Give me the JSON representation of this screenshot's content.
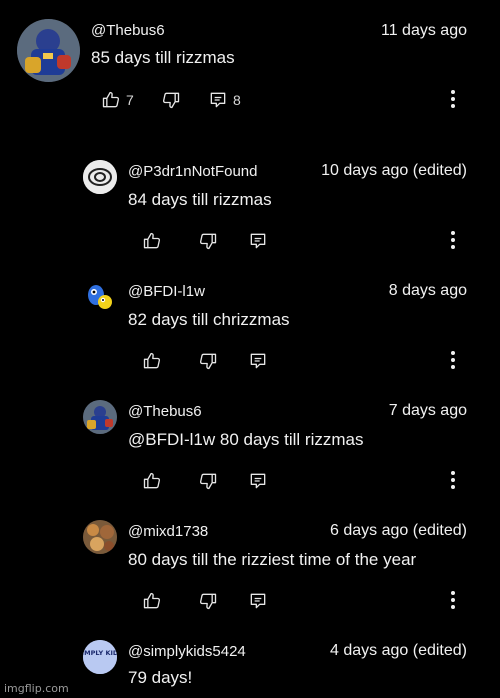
{
  "comments": [
    {
      "handle": "@Thebus6",
      "time": "11 days ago",
      "text": "85 days till rizzmas",
      "likes": "7",
      "replies": "8",
      "avatar_icon": "football-player-avatar-icon"
    },
    {
      "handle": "@P3dr1nNotFound",
      "time": "10 days ago (edited)",
      "text": "84 days till rizzmas",
      "avatar_icon": "sketch-avatar-icon"
    },
    {
      "handle": "@BFDI-l1w",
      "time": "8 days ago",
      "text": "82 days till chrizzmas",
      "avatar_icon": "cartoon-character-avatar-icon"
    },
    {
      "handle": "@Thebus6",
      "time": "7 days ago",
      "text": "@BFDI-l1w 80 days till rizzmas",
      "avatar_icon": "football-player-avatar-icon"
    },
    {
      "handle": "@mixd1738",
      "time": "6 days ago (edited)",
      "text": "80 days till the rizziest time of the year",
      "avatar_icon": "food-photo-avatar-icon"
    },
    {
      "handle": "@simplykids5424",
      "time": "4 days ago (edited)",
      "text": "79 days!",
      "avatar_icon": "simply-kids-logo-avatar-icon",
      "avatar_logo_text": "SIMPLY KIDS"
    }
  ],
  "watermark": "imgflip.com",
  "colors": {
    "background": "#000000",
    "text": "#f1f1f1"
  }
}
